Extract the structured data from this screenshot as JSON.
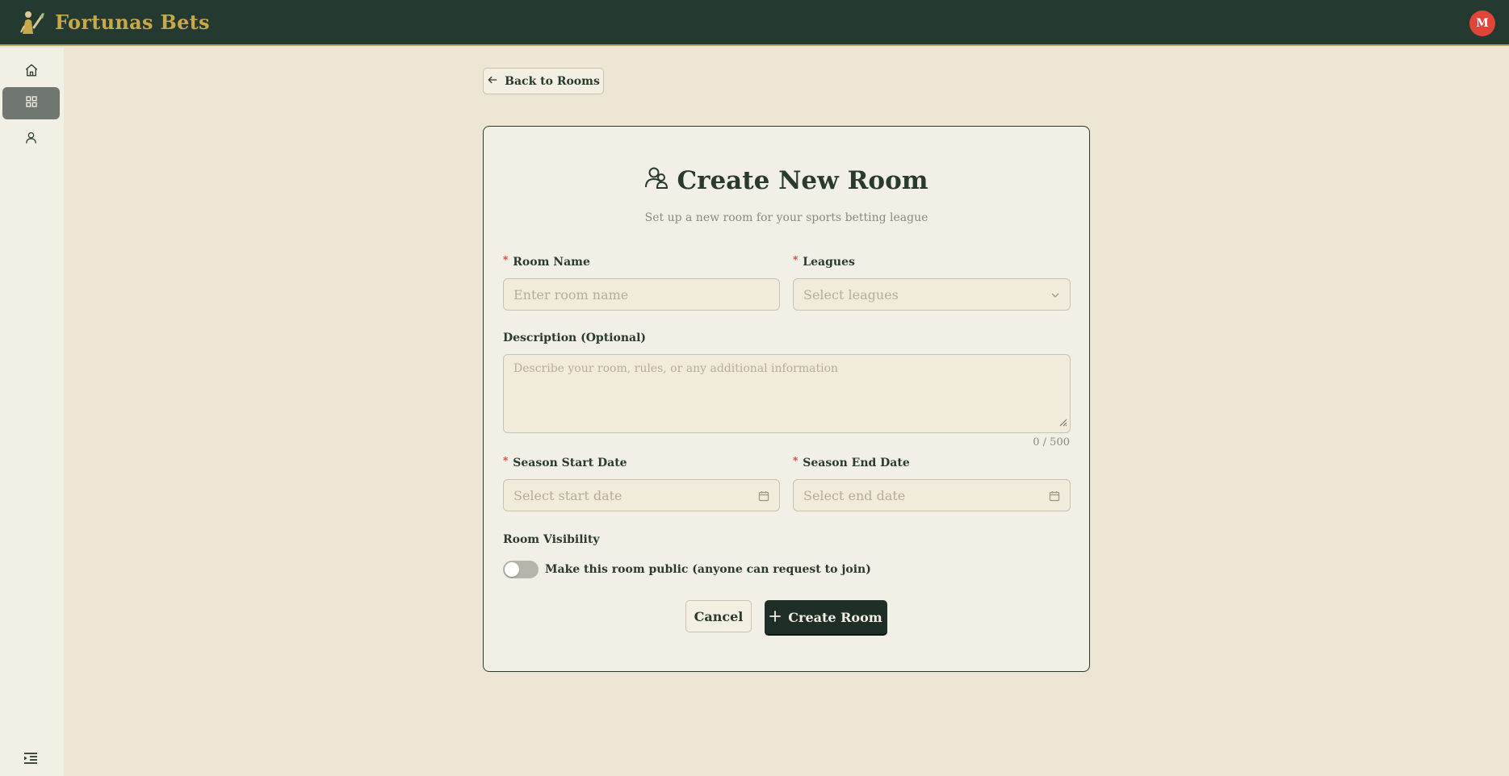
{
  "app": {
    "brand": "Fortunas Bets",
    "avatar_initial": "M",
    "brand_color": "#c9a84a",
    "header_color": "#243a30"
  },
  "sidebar": {
    "items": [
      {
        "name": "home",
        "icon": "home-icon",
        "active": false
      },
      {
        "name": "rooms",
        "icon": "grid-icon",
        "active": true
      },
      {
        "name": "profile",
        "icon": "user-icon",
        "active": false
      }
    ],
    "collapse_icon": "menu-indent-icon"
  },
  "back_button": {
    "label": "Back to Rooms"
  },
  "form": {
    "title": "Create New Room",
    "subtitle": "Set up a new room for your sports betting league",
    "room_name": {
      "label": "Room Name",
      "placeholder": "Enter room name",
      "required_mark": "*"
    },
    "leagues": {
      "label": "Leagues",
      "placeholder": "Select leagues",
      "required_mark": "*"
    },
    "description": {
      "label": "Description (Optional)",
      "placeholder": "Describe your room, rules, or any additional information",
      "counter": "0 / 500"
    },
    "start_date": {
      "label": "Season Start Date",
      "placeholder": "Select start date",
      "required_mark": "*"
    },
    "end_date": {
      "label": "Season End Date",
      "placeholder": "Select end date",
      "required_mark": "*"
    },
    "visibility": {
      "label": "Room Visibility",
      "toggle_text": "Make this room public (anyone can request to join)",
      "is_public": false
    },
    "cancel_label": "Cancel",
    "create_label": "Create Room"
  }
}
